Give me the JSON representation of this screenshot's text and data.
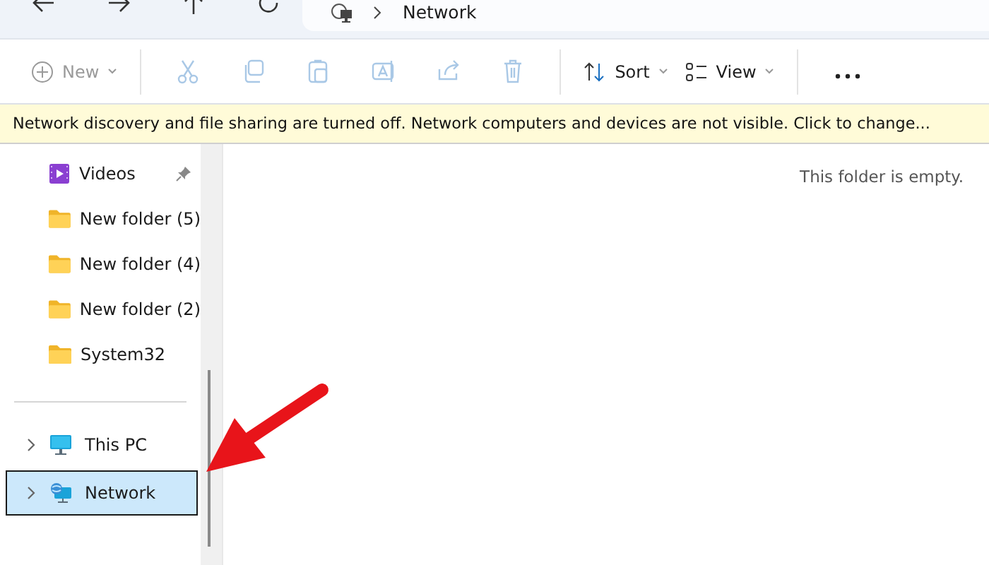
{
  "address_bar": {
    "path": [
      "Network"
    ]
  },
  "toolbar": {
    "new": {
      "label": "New",
      "disabled": true
    },
    "actions": [
      {
        "kind": "cut",
        "disabled": true
      },
      {
        "kind": "copy",
        "disabled": true
      },
      {
        "kind": "paste",
        "disabled": true
      },
      {
        "kind": "rename",
        "disabled": true
      },
      {
        "kind": "share",
        "disabled": true
      },
      {
        "kind": "delete",
        "disabled": true
      }
    ],
    "menus": [
      {
        "kind": "sort",
        "label": "Sort"
      },
      {
        "kind": "view",
        "label": "View"
      }
    ]
  },
  "info_bar": {
    "text": "Network discovery and file sharing are turned off. Network computers and devices are not visible. Click to change..."
  },
  "sidebar": {
    "quick_access": [
      {
        "label": "Videos",
        "kind": "video",
        "pinned": true
      },
      {
        "label": "New folder (5)",
        "kind": "folder",
        "pinned": false
      },
      {
        "label": "New folder (4)",
        "kind": "folder",
        "pinned": false
      },
      {
        "label": "New folder (2)",
        "kind": "folder",
        "pinned": false
      },
      {
        "label": "System32",
        "kind": "folder",
        "pinned": false
      }
    ],
    "locations": [
      {
        "label": "This PC",
        "kind": "pc",
        "expanded": false,
        "selected": false
      },
      {
        "label": "Network",
        "kind": "network",
        "expanded": false,
        "selected": true
      }
    ]
  },
  "content": {
    "empty_message": "This folder is empty."
  }
}
